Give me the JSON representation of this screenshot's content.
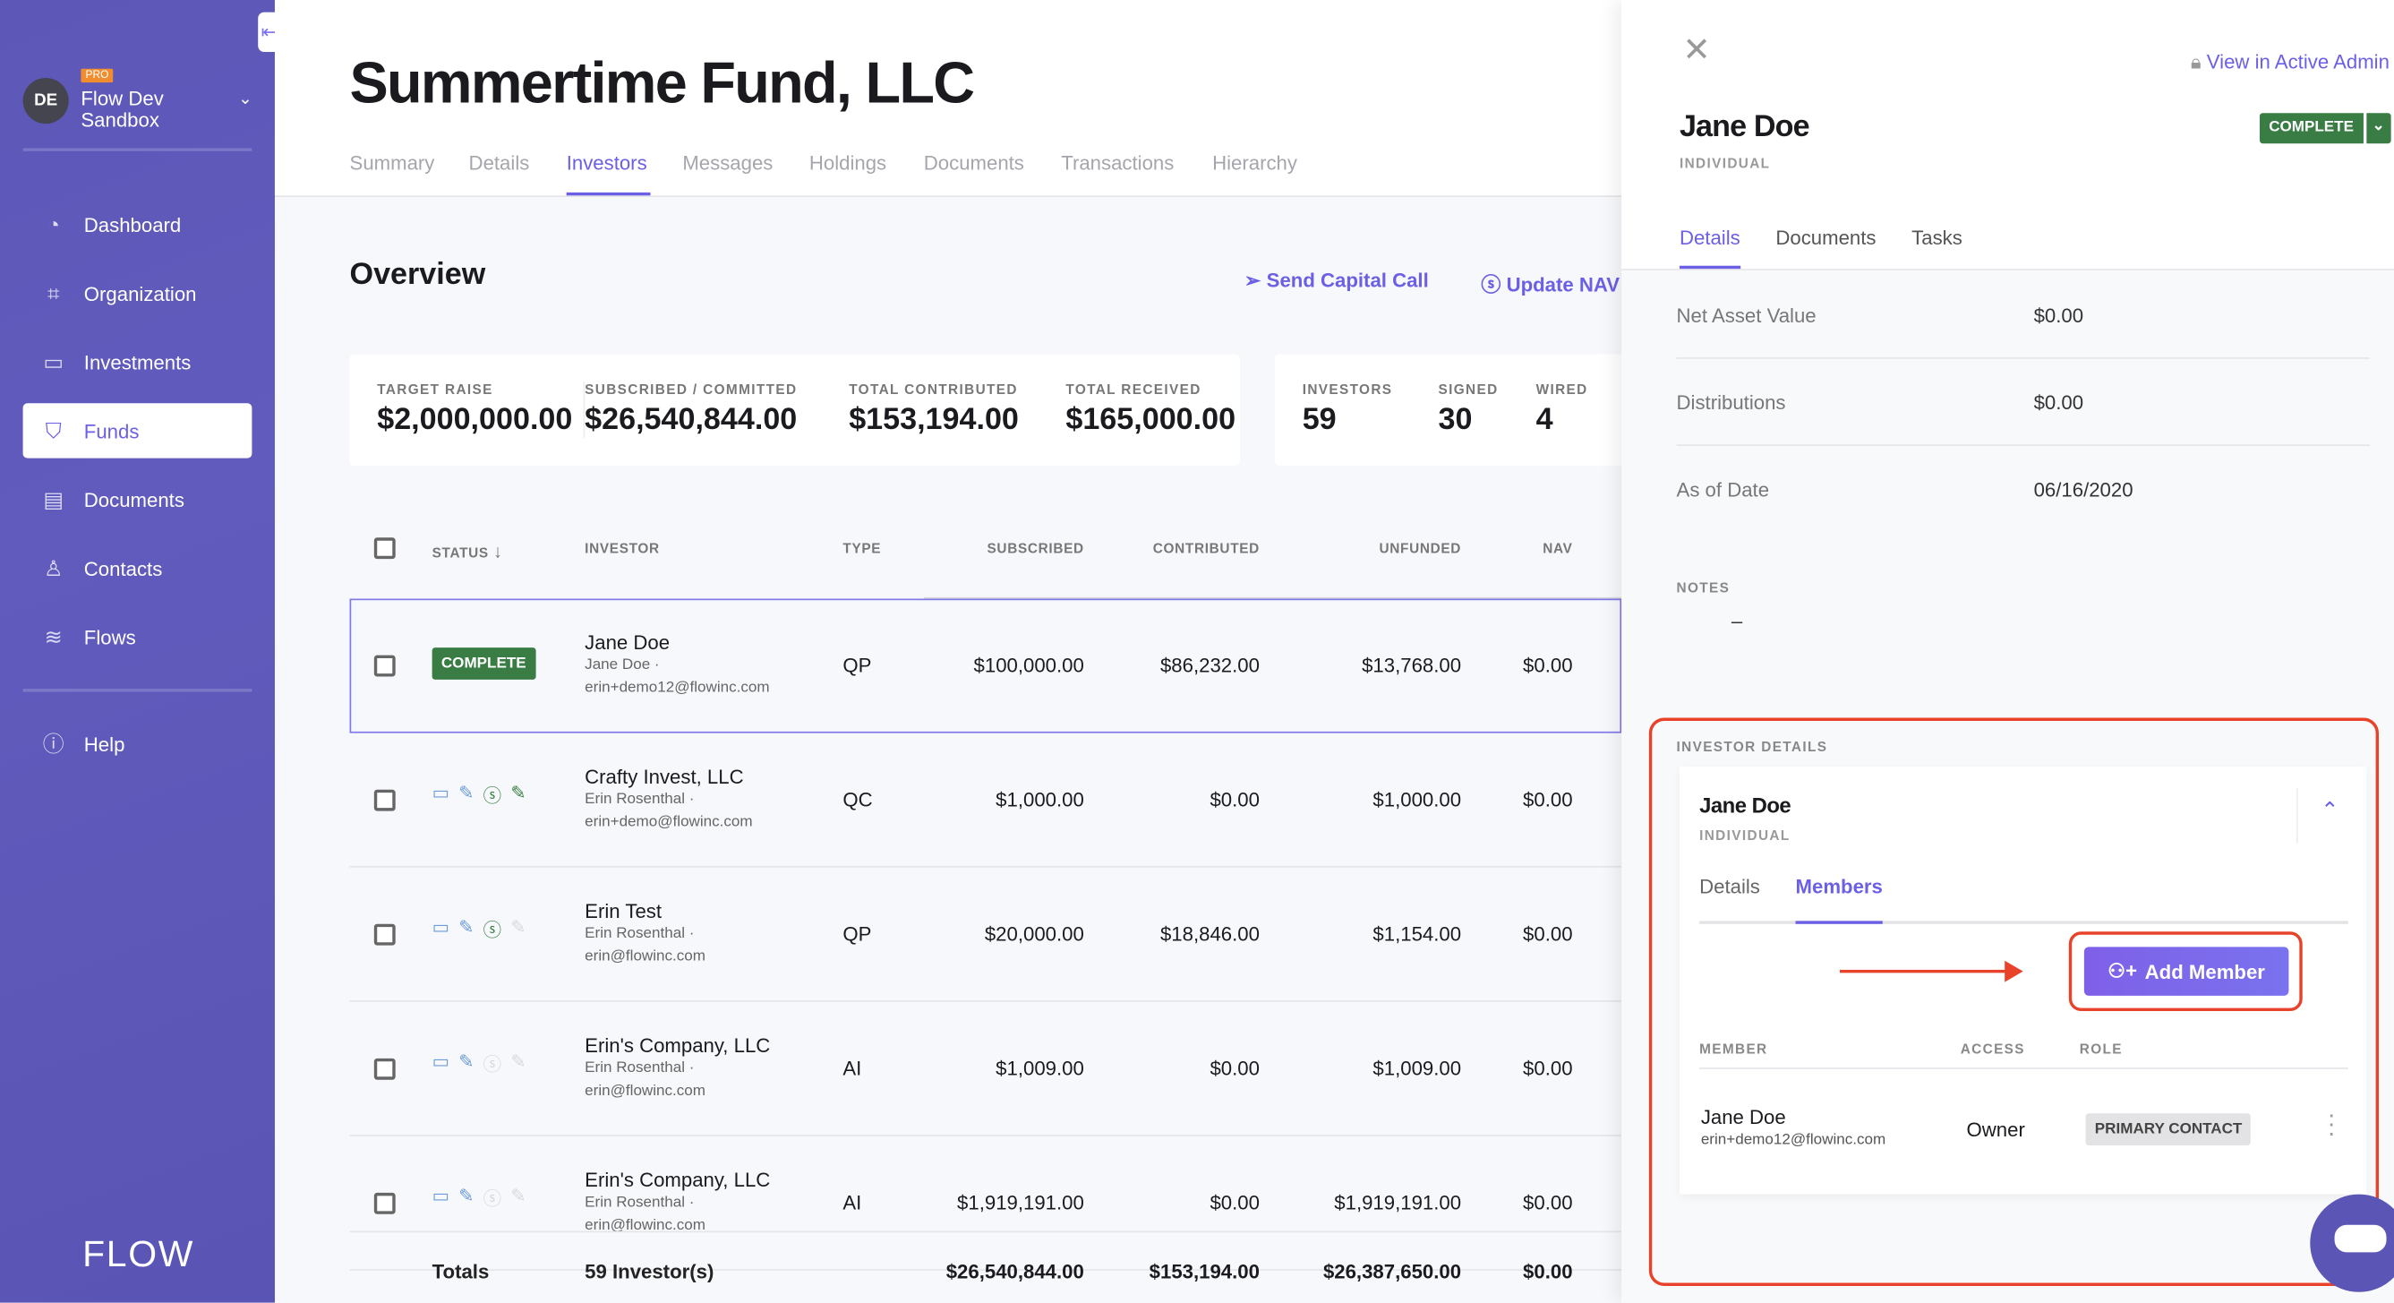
{
  "sidebar": {
    "collapse_icon": "collapse-left-icon",
    "org": {
      "initials": "DE",
      "plan_badge": "PRO",
      "name": "Flow Dev Sandbox"
    },
    "items": [
      {
        "label": "Dashboard",
        "icon": "dashboard-gauge-icon"
      },
      {
        "label": "Organization",
        "icon": "organization-icon"
      },
      {
        "label": "Investments",
        "icon": "briefcase-icon"
      },
      {
        "label": "Funds",
        "icon": "shield-icon",
        "active": true
      },
      {
        "label": "Documents",
        "icon": "document-icon"
      },
      {
        "label": "Contacts",
        "icon": "person-icon"
      },
      {
        "label": "Flows",
        "icon": "layers-icon"
      }
    ],
    "help": "Help",
    "logo": "FLOW"
  },
  "header": {
    "title": "Summertime Fund, LLC",
    "tabs": [
      "Summary",
      "Details",
      "Investors",
      "Messages",
      "Holdings",
      "Documents",
      "Transactions",
      "Hierarchy"
    ],
    "active_tab": "Investors"
  },
  "overview": {
    "title": "Overview",
    "send_capital_call": "Send Capital Call",
    "update_nav": "Update NAV",
    "stats": [
      {
        "label": "TARGET RAISE",
        "value": "$2,000,000.00"
      },
      {
        "label": "SUBSCRIBED / COMMITTED",
        "value": "$26,540,844.00"
      },
      {
        "label": "TOTAL CONTRIBUTED",
        "value": "$153,194.00"
      },
      {
        "label": "TOTAL RECEIVED",
        "value": "$165,000.00"
      }
    ],
    "counts": [
      {
        "label": "INVESTORS",
        "value": "59"
      },
      {
        "label": "SIGNED",
        "value": "30"
      },
      {
        "label": "WIRED",
        "value": "4"
      }
    ]
  },
  "table": {
    "columns": [
      "STATUS",
      "INVESTOR",
      "TYPE",
      "SUBSCRIBED",
      "CONTRIBUTED",
      "UNFUNDED",
      "NAV"
    ],
    "rows": [
      {
        "status": "COMPLETE",
        "name": "Jane Doe",
        "contact": "Jane Doe ·",
        "email": "erin+demo12@flowinc.com",
        "type": "QP",
        "subscribed": "$100,000.00",
        "contributed": "$86,232.00",
        "unfunded": "$13,768.00",
        "nav": "$0.00",
        "steps": []
      },
      {
        "status": "",
        "name": "Crafty Invest, LLC",
        "contact": "Erin Rosenthal ·",
        "email": "erin+demo@flowinc.com",
        "type": "QC",
        "subscribed": "$1,000.00",
        "contributed": "$0.00",
        "unfunded": "$1,000.00",
        "nav": "$0.00",
        "steps": [
          "done",
          "done",
          "green",
          "green"
        ]
      },
      {
        "status": "",
        "name": "Erin Test",
        "contact": "Erin Rosenthal ·",
        "email": "erin@flowinc.com",
        "type": "QP",
        "subscribed": "$20,000.00",
        "contributed": "$18,846.00",
        "unfunded": "$1,154.00",
        "nav": "$0.00",
        "steps": [
          "done",
          "done",
          "green",
          "off"
        ]
      },
      {
        "status": "",
        "name": "Erin's Company, LLC",
        "contact": "Erin Rosenthal ·",
        "email": "erin@flowinc.com",
        "type": "AI",
        "subscribed": "$1,009.00",
        "contributed": "$0.00",
        "unfunded": "$1,009.00",
        "nav": "$0.00",
        "steps": [
          "done",
          "done",
          "off",
          "off"
        ]
      },
      {
        "status": "",
        "name": "Erin's Company, LLC",
        "contact": "Erin Rosenthal ·",
        "email": "erin@flowinc.com",
        "type": "AI",
        "subscribed": "$1,919,191.00",
        "contributed": "$0.00",
        "unfunded": "$1,919,191.00",
        "nav": "$0.00",
        "steps": [
          "done",
          "done",
          "off",
          "off"
        ]
      }
    ],
    "totals": {
      "label": "Totals",
      "count": "59 Investor(s)",
      "subscribed": "$26,540,844.00",
      "contributed": "$153,194.00",
      "unfunded": "$26,387,650.00",
      "nav": "$0.00"
    }
  },
  "panel": {
    "admin_link": "View in Active Admin",
    "name": "Jane Doe",
    "kind": "INDIVIDUAL",
    "status": "COMPLETE",
    "tabs": [
      "Details",
      "Documents",
      "Tasks"
    ],
    "fields": [
      {
        "label": "Net Asset Value",
        "value": "$0.00"
      },
      {
        "label": "Distributions",
        "value": "$0.00"
      },
      {
        "label": "As of Date",
        "value": "06/16/2020"
      }
    ],
    "notes_label": "NOTES",
    "notes_value": "–",
    "investor_details": {
      "title": "INVESTOR DETAILS",
      "name": "Jane Doe",
      "kind": "INDIVIDUAL",
      "tabs": [
        "Details",
        "Members"
      ],
      "active_tab": "Members",
      "add_member": "Add Member",
      "columns": [
        "MEMBER",
        "ACCESS",
        "ROLE"
      ],
      "members": [
        {
          "name": "Jane Doe",
          "email": "erin+demo12@flowinc.com",
          "access": "Owner",
          "role": "PRIMARY CONTACT"
        }
      ]
    }
  },
  "colors": {
    "accent": "#6b5fe6",
    "sidebar": "#5d57b8",
    "complete": "#3a7d44",
    "annotation": "#e8432a"
  }
}
